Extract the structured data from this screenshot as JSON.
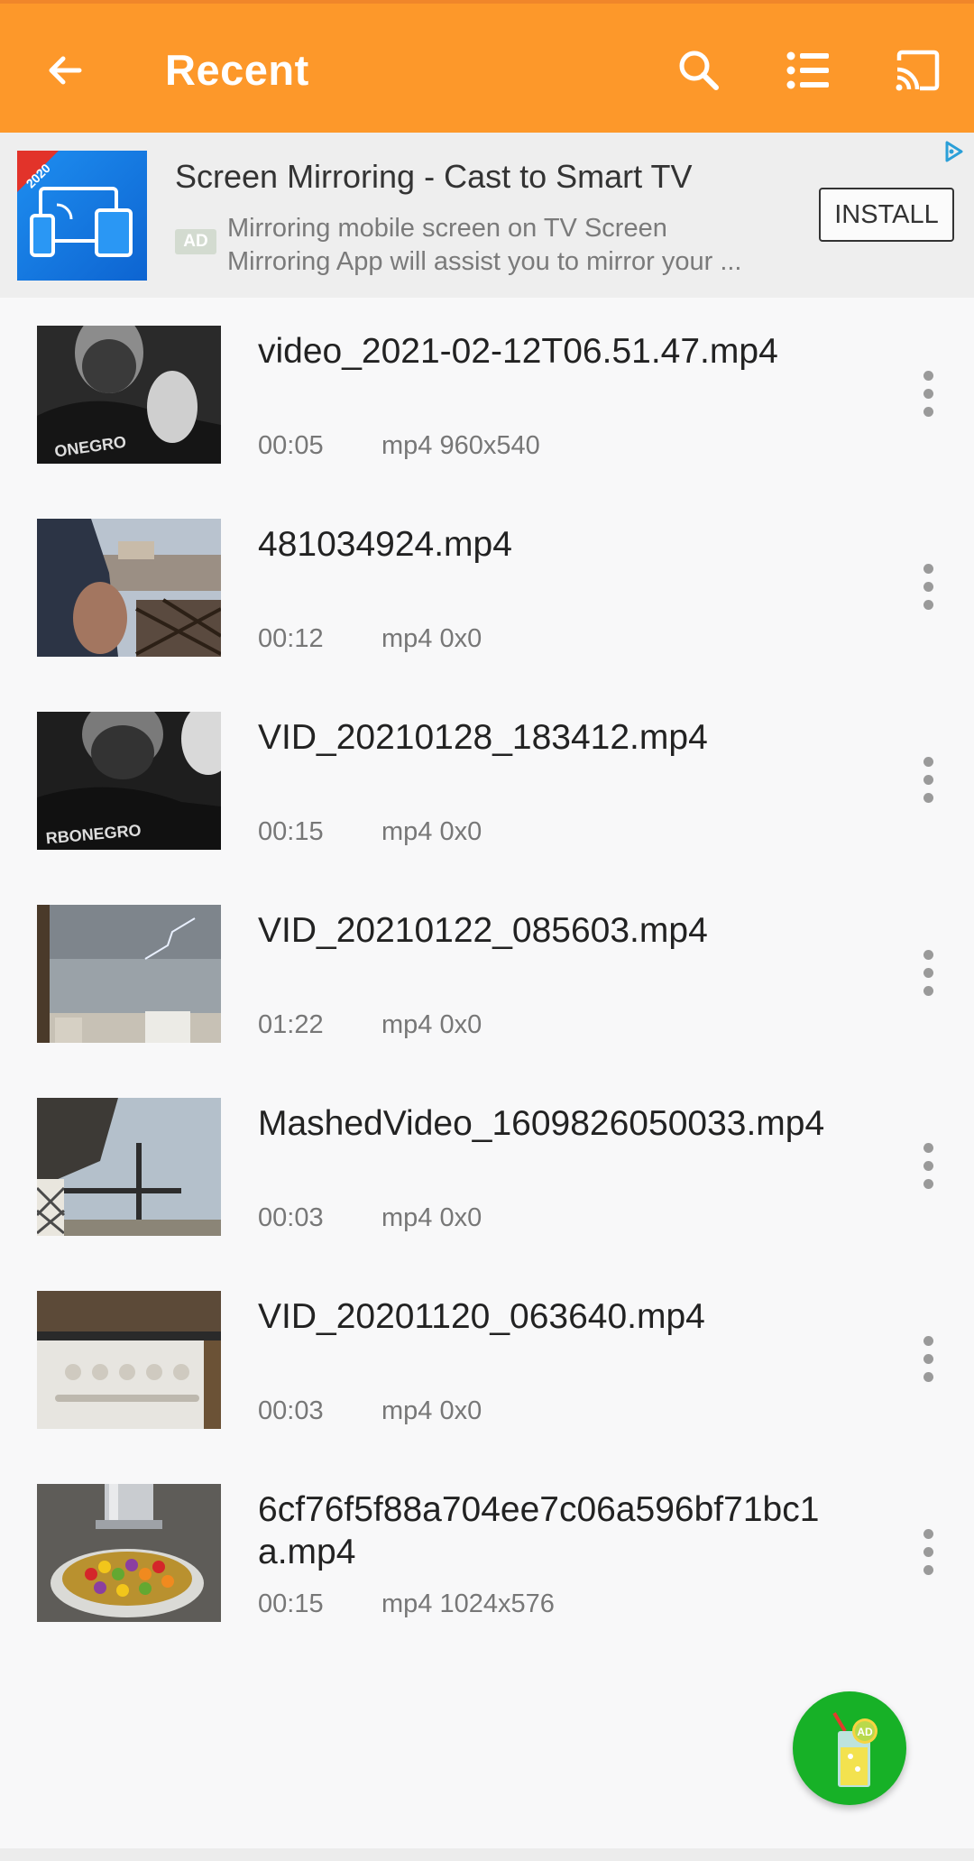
{
  "header": {
    "title": "Recent",
    "icons": [
      "back-arrow-icon",
      "search-icon",
      "list-view-icon",
      "cast-icon"
    ]
  },
  "ad": {
    "title": "Screen Mirroring - Cast to Smart TV",
    "badge": "AD",
    "desc_line1": "Mirroring mobile screen on TV Screen",
    "desc_line2": "Mirroring App will assist you to mirror your ...",
    "install_label": "INSTALL",
    "thumb_year": "2020"
  },
  "videos": [
    {
      "name": "video_2021-02-12T06.51.47.mp4",
      "duration": "00:05",
      "meta": "mp4 960x540"
    },
    {
      "name": "481034924.mp4",
      "duration": "00:12",
      "meta": "mp4 0x0"
    },
    {
      "name": "VID_20210128_183412.mp4",
      "duration": "00:15",
      "meta": "mp4 0x0"
    },
    {
      "name": "VID_20210122_085603.mp4",
      "duration": "01:22",
      "meta": "mp4 0x0"
    },
    {
      "name": "MashedVideo_1609826050033.mp4",
      "duration": "00:03",
      "meta": "mp4 0x0"
    },
    {
      "name": "VID_20201120_063640.mp4",
      "duration": "00:03",
      "meta": "mp4 0x0"
    },
    {
      "name": "6cf76f5f88a704ee7c06a596bf71bc1a.mp4",
      "duration": "00:15",
      "meta": "mp4 1024x576"
    }
  ],
  "fab": {
    "badge": "AD"
  },
  "colors": {
    "accent": "#fd982a",
    "fab": "#17b127"
  }
}
